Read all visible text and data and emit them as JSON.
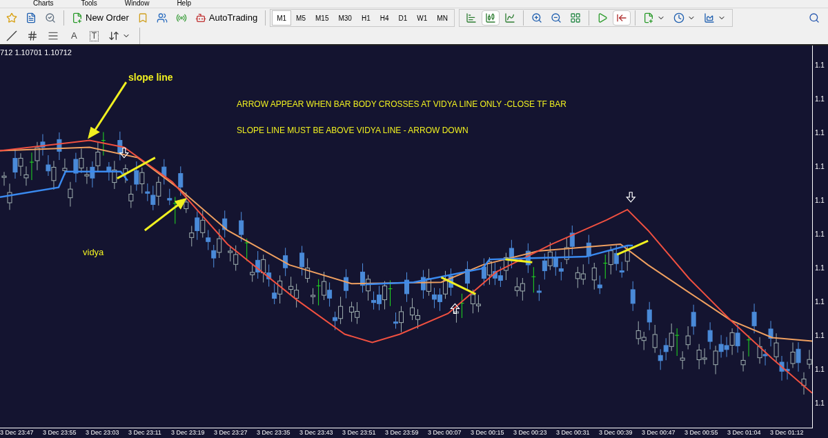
{
  "menu": [
    "Charts",
    "Tools",
    "Window",
    "Help"
  ],
  "toolbar": {
    "new_order": "New Order",
    "autotrading": "AutoTrading",
    "timeframes": [
      {
        "label": "M1",
        "selected": true
      },
      {
        "label": "M5",
        "selected": false
      },
      {
        "label": "M15",
        "selected": false
      },
      {
        "label": "M30",
        "selected": false
      },
      {
        "label": "H1",
        "selected": false
      },
      {
        "label": "H4",
        "selected": false
      },
      {
        "label": "D1",
        "selected": false
      },
      {
        "label": "W1",
        "selected": false
      },
      {
        "label": "MN",
        "selected": false
      }
    ],
    "chart_types": [
      {
        "kind": "bars",
        "selected": false
      },
      {
        "kind": "candles",
        "selected": true
      },
      {
        "kind": "line",
        "selected": false
      }
    ],
    "chart_tools": [
      {
        "kind": "autoscroll",
        "selected": false
      },
      {
        "kind": "shift",
        "selected": true
      }
    ]
  },
  "drawing_toolbar": {
    "text_tool": "A",
    "label_tool": "T"
  },
  "chart": {
    "ohlc": "712 1.10701 1.10712",
    "annotations": [
      {
        "text": "slope line"
      },
      {
        "text": "ARROW APPEAR WHEN BAR BODY CROSSES AT VIDYA LINE  ONLY -CLOSE TF BAR"
      },
      {
        "text": "SLOPE LINE MUST BE ABOVE  VIDYA LINE - ARROW DOWN"
      },
      {
        "text": "vidya"
      }
    ],
    "price_labels": [
      "1.1",
      "1.1",
      "1.1",
      "1.1",
      "1.1",
      "1.1",
      "1.1",
      "1.1",
      "1.1",
      "1.1",
      "1.1"
    ],
    "time_labels": [
      "3 Dec 23:47",
      "3 Dec 23:55",
      "3 Dec 23:03",
      "3 Dec 23:11",
      "3 Dec 23:19",
      "3 Dec 23:27",
      "3 Dec 23:35",
      "3 Dec 23:43",
      "3 Dec 23:51",
      "3 Dec 23:59",
      "3 Dec 00:07",
      "3 Dec 00:15",
      "3 Dec 00:23",
      "3 Dec 00:31",
      "3 Dec 00:39",
      "3 Dec 00:47",
      "3 Dec 00:55",
      "3 Dec 01:04",
      "3 Dec 01:12"
    ]
  }
}
